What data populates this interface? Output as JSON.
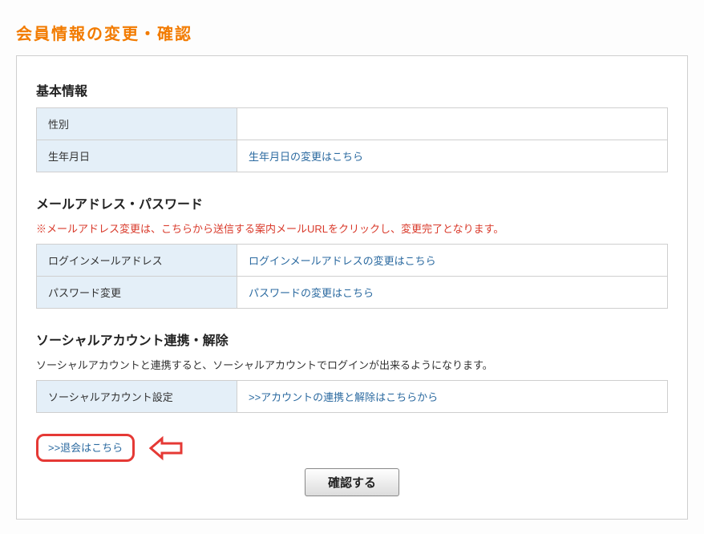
{
  "page_title": "会員情報の変更・確認",
  "sections": {
    "basic": {
      "title": "基本情報",
      "rows": {
        "gender": {
          "label": "性別",
          "value": ""
        },
        "birthday": {
          "label": "生年月日",
          "link": "生年月日の変更はこちら"
        }
      }
    },
    "mail": {
      "title": "メールアドレス・パスワード",
      "note": "※メールアドレス変更は、こちらから送信する案内メールURLをクリックし、変更完了となります。",
      "rows": {
        "login_mail": {
          "label": "ログインメールアドレス",
          "link": "ログインメールアドレスの変更はこちら"
        },
        "password": {
          "label": "パスワード変更",
          "link": "パスワードの変更はこちら"
        }
      }
    },
    "social": {
      "title": "ソーシャルアカウント連携・解除",
      "desc": "ソーシャルアカウントと連携すると、ソーシャルアカウントでログインが出来るようになります。",
      "rows": {
        "setting": {
          "label": "ソーシャルアカウント設定",
          "link": ">>アカウントの連携と解除はこちらから"
        }
      }
    }
  },
  "withdraw_link": ">>退会はこちら",
  "submit_label": "確認する"
}
